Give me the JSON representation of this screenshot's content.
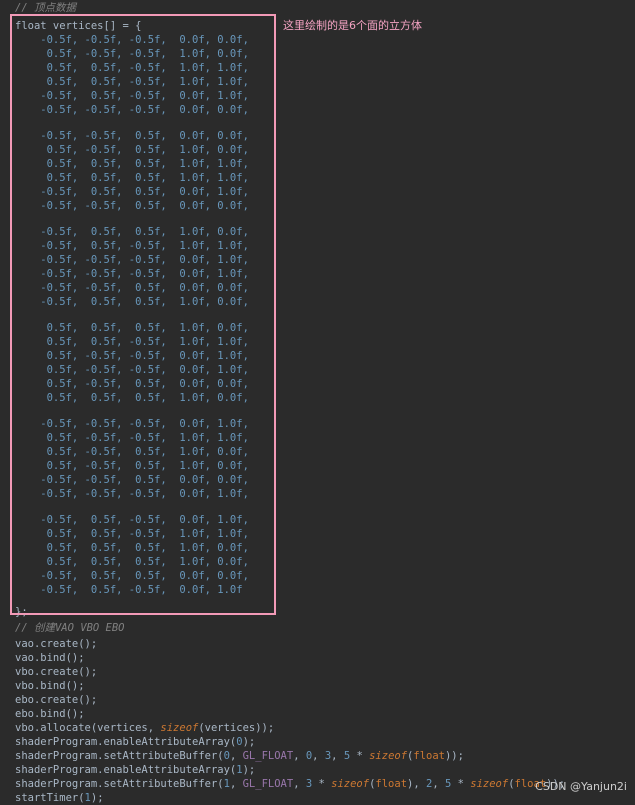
{
  "annotation": "这里绘制的是6个面的立方体",
  "watermark": "CSDN @Yanjun2i",
  "code": {
    "comment_vertices": "// 顶点数据",
    "decl": "float vertices[] = {",
    "faces": [
      [
        "    -0.5f, -0.5f, -0.5f,  0.0f, 0.0f,",
        "     0.5f, -0.5f, -0.5f,  1.0f, 0.0f,",
        "     0.5f,  0.5f, -0.5f,  1.0f, 1.0f,",
        "     0.5f,  0.5f, -0.5f,  1.0f, 1.0f,",
        "    -0.5f,  0.5f, -0.5f,  0.0f, 1.0f,",
        "    -0.5f, -0.5f, -0.5f,  0.0f, 0.0f,"
      ],
      [
        "    -0.5f, -0.5f,  0.5f,  0.0f, 0.0f,",
        "     0.5f, -0.5f,  0.5f,  1.0f, 0.0f,",
        "     0.5f,  0.5f,  0.5f,  1.0f, 1.0f,",
        "     0.5f,  0.5f,  0.5f,  1.0f, 1.0f,",
        "    -0.5f,  0.5f,  0.5f,  0.0f, 1.0f,",
        "    -0.5f, -0.5f,  0.5f,  0.0f, 0.0f,"
      ],
      [
        "    -0.5f,  0.5f,  0.5f,  1.0f, 0.0f,",
        "    -0.5f,  0.5f, -0.5f,  1.0f, 1.0f,",
        "    -0.5f, -0.5f, -0.5f,  0.0f, 1.0f,",
        "    -0.5f, -0.5f, -0.5f,  0.0f, 1.0f,",
        "    -0.5f, -0.5f,  0.5f,  0.0f, 0.0f,",
        "    -0.5f,  0.5f,  0.5f,  1.0f, 0.0f,"
      ],
      [
        "     0.5f,  0.5f,  0.5f,  1.0f, 0.0f,",
        "     0.5f,  0.5f, -0.5f,  1.0f, 1.0f,",
        "     0.5f, -0.5f, -0.5f,  0.0f, 1.0f,",
        "     0.5f, -0.5f, -0.5f,  0.0f, 1.0f,",
        "     0.5f, -0.5f,  0.5f,  0.0f, 0.0f,",
        "     0.5f,  0.5f,  0.5f,  1.0f, 0.0f,"
      ],
      [
        "    -0.5f, -0.5f, -0.5f,  0.0f, 1.0f,",
        "     0.5f, -0.5f, -0.5f,  1.0f, 1.0f,",
        "     0.5f, -0.5f,  0.5f,  1.0f, 0.0f,",
        "     0.5f, -0.5f,  0.5f,  1.0f, 0.0f,",
        "    -0.5f, -0.5f,  0.5f,  0.0f, 0.0f,",
        "    -0.5f, -0.5f, -0.5f,  0.0f, 1.0f,"
      ],
      [
        "    -0.5f,  0.5f, -0.5f,  0.0f, 1.0f,",
        "     0.5f,  0.5f, -0.5f,  1.0f, 1.0f,",
        "     0.5f,  0.5f,  0.5f,  1.0f, 0.0f,",
        "     0.5f,  0.5f,  0.5f,  1.0f, 0.0f,",
        "    -0.5f,  0.5f,  0.5f,  0.0f, 0.0f,",
        "    -0.5f,  0.5f, -0.5f,  0.0f, 1.0f"
      ]
    ],
    "close": "};",
    "comment_create": "// 创建VAO VBO EBO",
    "statements": [
      "vao.create();",
      "vao.bind();",
      "vbo.create();",
      "vbo.bind();",
      "ebo.create();",
      "ebo.bind();",
      "vbo.allocate(vertices, sizeof(vertices));",
      "shaderProgram.enableAttributeArray(0);",
      "shaderProgram.setAttributeBuffer(0, GL_FLOAT, 0, 3, 5 * sizeof(float));",
      "shaderProgram.enableAttributeArray(1);",
      "shaderProgram.setAttributeBuffer(1, GL_FLOAT, 3 * sizeof(float), 2, 5 * sizeof(float));",
      "startTimer(1);"
    ]
  },
  "colors": {
    "background": "#2b2b2b",
    "highlight_border": "#f29ab7",
    "annotation_text": "#f4a3c3",
    "number": "#6897bb",
    "keyword": "#cc7832",
    "comment": "#808080"
  }
}
